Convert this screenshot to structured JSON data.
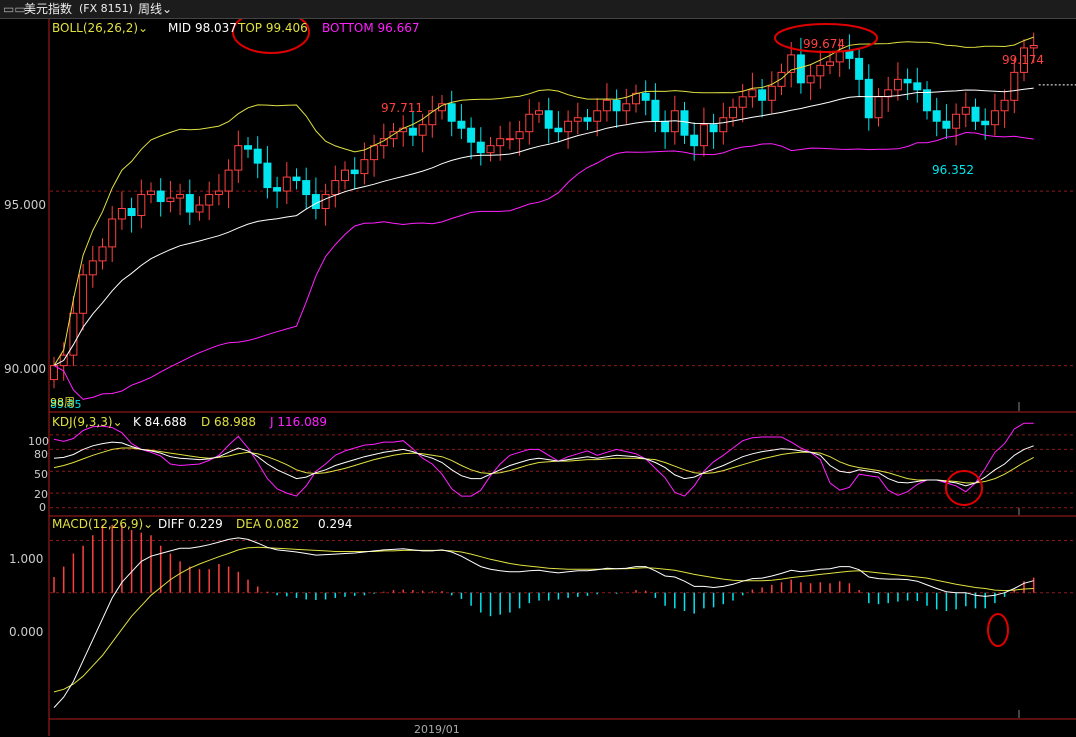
{
  "window": {
    "title": "美元指数",
    "code": "(FX 8151)",
    "period": "周线"
  },
  "colors": {
    "up": "#ff4040",
    "down": "#00e5ee",
    "mid": "#ffffff",
    "top": "#e0e040",
    "bottom": "#ff20ff",
    "axis": "#b41e1e",
    "grid": "#8b1a1a",
    "text": "#cccccc"
  },
  "boll": {
    "name": "BOLL(26,26,2)",
    "mid_label": "MID 98.037",
    "top_label": "TOP 99.406",
    "bottom_label": "BOTTOM 96.667"
  },
  "kdj": {
    "name": "KDJ(9,3,3)",
    "k_label": "K 84.688",
    "d_label": "D 68.988",
    "j_label": "J 116.089",
    "ticks": [
      "100",
      "80",
      "50",
      "20",
      "0"
    ]
  },
  "macd": {
    "name": "MACD(12,26,9)",
    "diff_label": "DIFF 0.229",
    "dea_label": "DEA 0.082",
    "macd_label": "0.294",
    "ticks": [
      "1.000",
      "0.000"
    ]
  },
  "price_annotations": {
    "high1": "97.711",
    "high2": "99.674",
    "low": "96.352",
    "last": "99.174",
    "start": "89.85",
    "cursor": "98周"
  },
  "x_axis": {
    "label": "2019/01"
  },
  "chart_data": {
    "type": "candlestick",
    "price_ticks": [
      "95.000",
      "90.000"
    ],
    "ylim_price": [
      88.7,
      99.9
    ],
    "ylim_kdj": [
      -10,
      130
    ],
    "ylim_macd": [
      -2.4,
      1.45
    ],
    "close": [
      90.0,
      90.3,
      91.5,
      92.6,
      93.0,
      93.4,
      94.2,
      94.5,
      94.3,
      94.9,
      95.0,
      94.7,
      94.8,
      94.9,
      94.4,
      94.6,
      94.9,
      95.0,
      95.6,
      96.3,
      96.2,
      95.8,
      95.1,
      95.0,
      95.4,
      95.3,
      94.9,
      94.5,
      94.9,
      95.3,
      95.6,
      95.5,
      95.9,
      96.3,
      96.5,
      96.7,
      96.8,
      96.6,
      96.9,
      97.3,
      97.5,
      97.0,
      96.8,
      96.4,
      96.1,
      96.3,
      96.5,
      96.5,
      96.7,
      97.2,
      97.3,
      96.8,
      96.7,
      97.0,
      97.1,
      97.0,
      97.3,
      97.6,
      97.3,
      97.5,
      97.8,
      97.6,
      97.0,
      96.7,
      97.3,
      96.6,
      96.3,
      96.9,
      96.7,
      97.1,
      97.4,
      97.7,
      97.9,
      97.6,
      98.0,
      98.4,
      98.9,
      98.1,
      98.3,
      98.6,
      98.7,
      99.0,
      98.8,
      98.2,
      97.1,
      97.7,
      97.9,
      98.2,
      98.1,
      97.9,
      97.3,
      97.0,
      96.8,
      97.2,
      97.4,
      97.0,
      96.9,
      97.3,
      97.6,
      98.4,
      99.1,
      99.17
    ],
    "kdj": {
      "k": [
        68,
        69,
        73,
        80,
        85,
        88,
        90,
        89,
        84,
        80,
        78,
        75,
        70,
        68,
        67,
        66,
        67,
        70,
        76,
        82,
        78,
        70,
        60,
        52,
        46,
        40,
        42,
        48,
        52,
        58,
        62,
        66,
        70,
        73,
        76,
        78,
        80,
        77,
        72,
        68,
        62,
        52,
        44,
        40,
        40,
        46,
        52,
        58,
        62,
        66,
        68,
        66,
        64,
        66,
        68,
        70,
        68,
        70,
        72,
        71,
        70,
        67,
        62,
        55,
        45,
        40,
        42,
        48,
        53,
        58,
        64,
        70,
        74,
        77,
        79,
        81,
        80,
        78,
        76,
        72,
        58,
        50,
        48,
        52,
        50,
        48,
        40,
        35,
        34,
        36,
        38,
        38,
        36,
        34,
        30,
        34,
        42,
        52,
        60,
        72,
        80,
        85
      ],
      "d": [
        55,
        58,
        62,
        67,
        72,
        76,
        80,
        82,
        82,
        80,
        79,
        77,
        75,
        73,
        71,
        69,
        68,
        69,
        71,
        74,
        76,
        74,
        70,
        65,
        59,
        52,
        48,
        47,
        48,
        51,
        54,
        58,
        62,
        66,
        69,
        72,
        74,
        75,
        74,
        72,
        70,
        65,
        58,
        52,
        48,
        47,
        48,
        51,
        55,
        59,
        62,
        63,
        64,
        64,
        65,
        66,
        66,
        67,
        68,
        68,
        68,
        67,
        66,
        62,
        57,
        52,
        48,
        47,
        48,
        51,
        55,
        59,
        63,
        67,
        70,
        73,
        75,
        76,
        76,
        75,
        70,
        63,
        58,
        55,
        53,
        51,
        48,
        44,
        40,
        38,
        38,
        38,
        37,
        36,
        34,
        34,
        36,
        40,
        46,
        54,
        62,
        69
      ],
      "j": [
        94,
        91,
        95,
        106,
        111,
        112,
        110,
        103,
        88,
        80,
        76,
        71,
        60,
        58,
        59,
        60,
        65,
        72,
        86,
        98,
        82,
        62,
        40,
        26,
        20,
        16,
        30,
        50,
        60,
        72,
        78,
        82,
        86,
        87,
        90,
        90,
        92,
        81,
        68,
        60,
        46,
        26,
        16,
        16,
        24,
        44,
        60,
        72,
        76,
        80,
        80,
        72,
        64,
        70,
        74,
        78,
        72,
        76,
        80,
        77,
        74,
        67,
        54,
        41,
        21,
        16,
        30,
        50,
        63,
        72,
        82,
        92,
        96,
        97,
        97,
        97,
        90,
        82,
        76,
        66,
        34,
        24,
        28,
        46,
        44,
        42,
        24,
        17,
        22,
        32,
        38,
        38,
        34,
        30,
        22,
        34,
        54,
        76,
        88,
        108,
        116,
        116
      ]
    },
    "macd": {
      "diff": [
        -2.2,
        -2.0,
        -1.7,
        -1.3,
        -0.9,
        -0.5,
        -0.1,
        0.2,
        0.4,
        0.6,
        0.7,
        0.75,
        0.8,
        0.85,
        0.85,
        0.88,
        0.92,
        0.97,
        1.02,
        1.05,
        1.02,
        0.95,
        0.87,
        0.82,
        0.8,
        0.78,
        0.75,
        0.72,
        0.73,
        0.74,
        0.75,
        0.76,
        0.78,
        0.8,
        0.82,
        0.83,
        0.84,
        0.82,
        0.8,
        0.8,
        0.82,
        0.78,
        0.7,
        0.6,
        0.5,
        0.45,
        0.42,
        0.4,
        0.4,
        0.42,
        0.43,
        0.4,
        0.38,
        0.4,
        0.42,
        0.42,
        0.44,
        0.47,
        0.46,
        0.47,
        0.5,
        0.5,
        0.42,
        0.32,
        0.3,
        0.22,
        0.12,
        0.12,
        0.1,
        0.12,
        0.16,
        0.22,
        0.27,
        0.28,
        0.32,
        0.37,
        0.43,
        0.4,
        0.42,
        0.45,
        0.46,
        0.5,
        0.5,
        0.44,
        0.3,
        0.27,
        0.26,
        0.26,
        0.25,
        0.22,
        0.15,
        0.08,
        0.02,
        0.0,
        0.0,
        -0.05,
        -0.07,
        -0.05,
        0.0,
        0.08,
        0.18,
        0.23
      ],
      "dea": [
        -1.9,
        -1.85,
        -1.75,
        -1.6,
        -1.4,
        -1.2,
        -0.95,
        -0.7,
        -0.45,
        -0.25,
        -0.05,
        0.1,
        0.25,
        0.37,
        0.47,
        0.55,
        0.62,
        0.69,
        0.75,
        0.82,
        0.86,
        0.87,
        0.86,
        0.85,
        0.84,
        0.83,
        0.82,
        0.81,
        0.8,
        0.79,
        0.79,
        0.79,
        0.79,
        0.79,
        0.8,
        0.8,
        0.81,
        0.81,
        0.81,
        0.81,
        0.81,
        0.8,
        0.78,
        0.74,
        0.69,
        0.64,
        0.6,
        0.56,
        0.53,
        0.51,
        0.49,
        0.47,
        0.46,
        0.45,
        0.45,
        0.45,
        0.45,
        0.45,
        0.46,
        0.46,
        0.47,
        0.48,
        0.47,
        0.45,
        0.43,
        0.39,
        0.35,
        0.32,
        0.29,
        0.26,
        0.24,
        0.23,
        0.23,
        0.23,
        0.24,
        0.26,
        0.29,
        0.31,
        0.33,
        0.35,
        0.37,
        0.39,
        0.41,
        0.42,
        0.4,
        0.38,
        0.36,
        0.34,
        0.32,
        0.3,
        0.28,
        0.24,
        0.2,
        0.16,
        0.13,
        0.1,
        0.08,
        0.05,
        0.04,
        0.05,
        0.07,
        0.08
      ],
      "hist": [
        0.3,
        0.5,
        0.75,
        0.9,
        1.1,
        1.3,
        1.3,
        1.3,
        1.2,
        1.15,
        1.1,
        0.9,
        0.75,
        0.6,
        0.5,
        0.45,
        0.45,
        0.55,
        0.5,
        0.4,
        0.25,
        0.12,
        0.02,
        -0.05,
        -0.07,
        -0.1,
        -0.13,
        -0.14,
        -0.13,
        -0.1,
        -0.08,
        -0.06,
        -0.05,
        -0.02,
        0.02,
        0.05,
        0.06,
        0.05,
        0.04,
        0.03,
        0.03,
        -0.05,
        -0.12,
        -0.25,
        -0.38,
        -0.45,
        -0.42,
        -0.38,
        -0.3,
        -0.2,
        -0.15,
        -0.15,
        -0.13,
        -0.1,
        -0.08,
        -0.06,
        -0.03,
        0.0,
        -0.02,
        0.0,
        0.05,
        0.04,
        -0.1,
        -0.25,
        -0.3,
        -0.35,
        -0.4,
        -0.3,
        -0.28,
        -0.22,
        -0.15,
        -0.05,
        0.06,
        0.1,
        0.15,
        0.2,
        0.25,
        0.2,
        0.18,
        0.2,
        0.18,
        0.22,
        0.18,
        0.05,
        -0.2,
        -0.22,
        -0.2,
        -0.17,
        -0.15,
        -0.16,
        -0.25,
        -0.32,
        -0.35,
        -0.32,
        -0.26,
        -0.3,
        -0.3,
        -0.2,
        -0.08,
        0.06,
        0.22,
        0.29
      ]
    }
  }
}
